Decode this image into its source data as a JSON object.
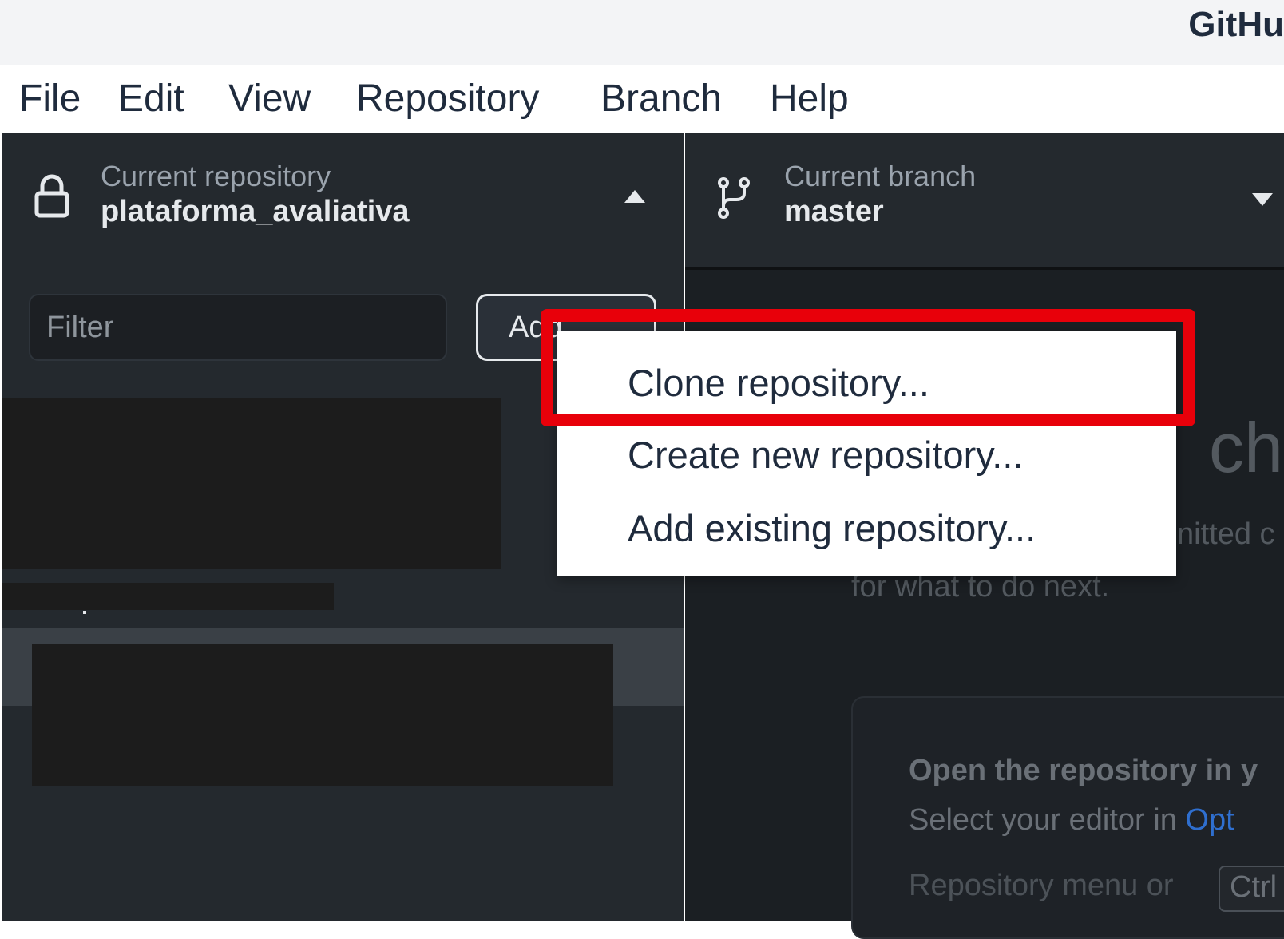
{
  "window": {
    "title": "GitHu"
  },
  "menu": [
    "File",
    "Edit",
    "View",
    "Repository",
    "Branch",
    "Help"
  ],
  "repository_selector": {
    "label": "Current repository",
    "value": "plataforma_avaliativa",
    "icon": "lock-icon",
    "toggle_icon": "caret-up-icon"
  },
  "branch_selector": {
    "label": "Current branch",
    "value": "master",
    "icon": "git-branch-icon",
    "toggle_icon": "caret-down-icon"
  },
  "filter": {
    "placeholder": "Filter"
  },
  "add_button": {
    "label": "Add"
  },
  "add_menu": {
    "items": [
      "Clone repository...",
      "Create new repository...",
      "Add existing repository..."
    ],
    "highlighted": "Clone repository..."
  },
  "background": {
    "heading_partial": "ch",
    "text_line1_partial": "nitted c",
    "text_line2": "for what to do next.",
    "card_title": "Open the repository in y",
    "card_line_prefix": "Select your editor in ",
    "card_line_link": "Opt",
    "card_line3_prefix": "Repository menu or ",
    "card_kbd": "Ctrl"
  },
  "colors": {
    "sidebar": "#24292e",
    "main": "#1b1f23",
    "highlight": "#e8000a",
    "link": "#2f6fcf"
  }
}
